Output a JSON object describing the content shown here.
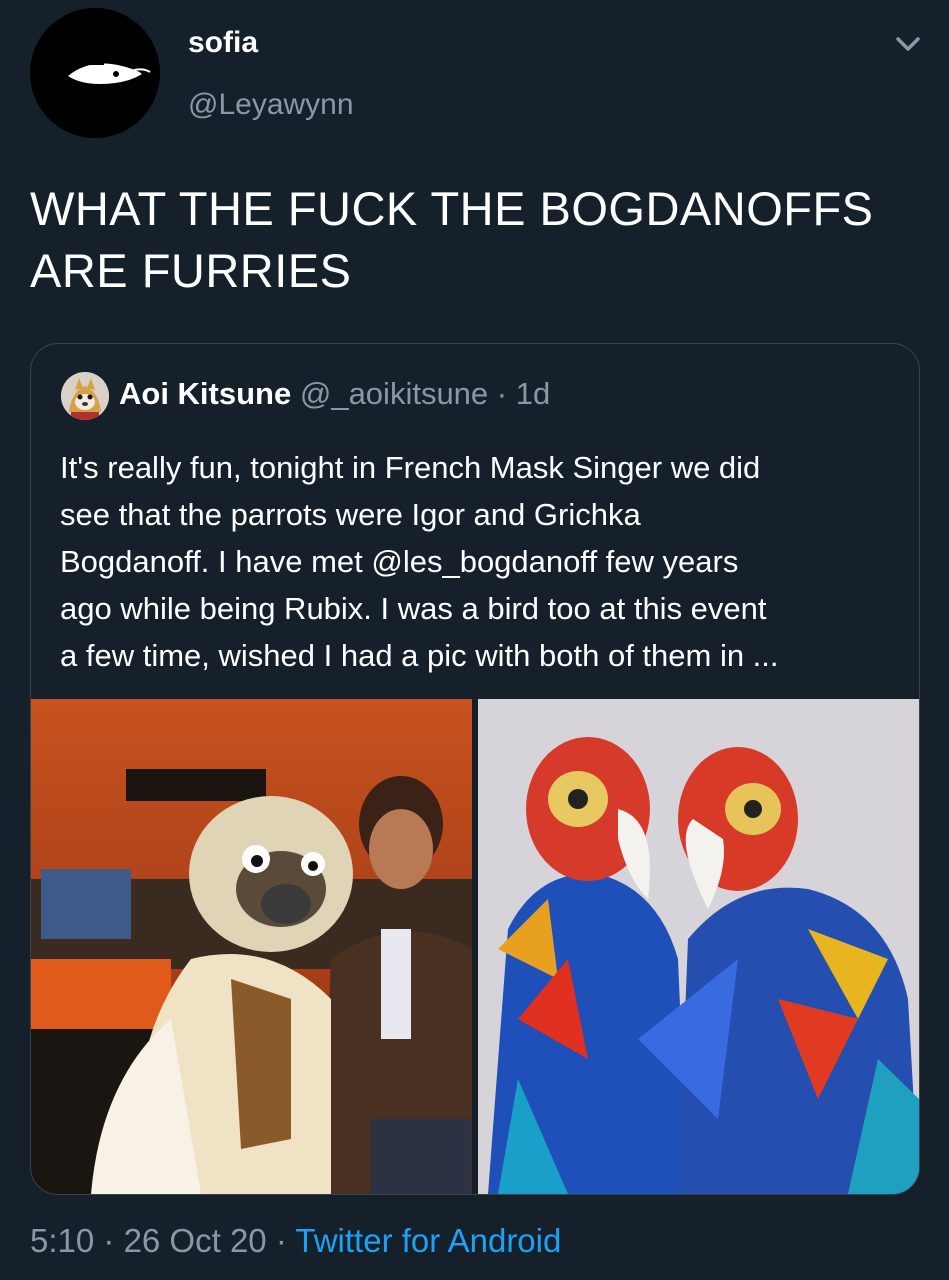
{
  "author": {
    "display_name": "sofia",
    "handle": "@Leyawynn"
  },
  "tweet": {
    "text_line1": "WHAT THE FUCK THE BOGDANOFFS",
    "text_line2": "ARE FURRIES"
  },
  "quoted_tweet": {
    "display_name": "Aoi Kitsune",
    "handle": "@_aoikitsune",
    "separator": "·",
    "age": "1d",
    "lines": [
      "It's really fun, tonight in French Mask Singer we did",
      "see that the parrots were Igor and Grichka",
      "Bogdanoff. I have met @les_bogdanoff few years",
      "ago while being Rubix. I was a bird too at this event",
      "a few time, wished I had a pic with both of them in ..."
    ]
  },
  "footer": {
    "time": "5:10",
    "sep1": " · ",
    "date": "26 Oct 20",
    "sep2": " · ",
    "source": "Twitter for Android"
  },
  "colors": {
    "background": "#15202b",
    "secondary_text": "#8899a6",
    "link": "#1da1f2",
    "border": "#38444d"
  },
  "icons": {
    "caret": "chevron-down-icon"
  }
}
